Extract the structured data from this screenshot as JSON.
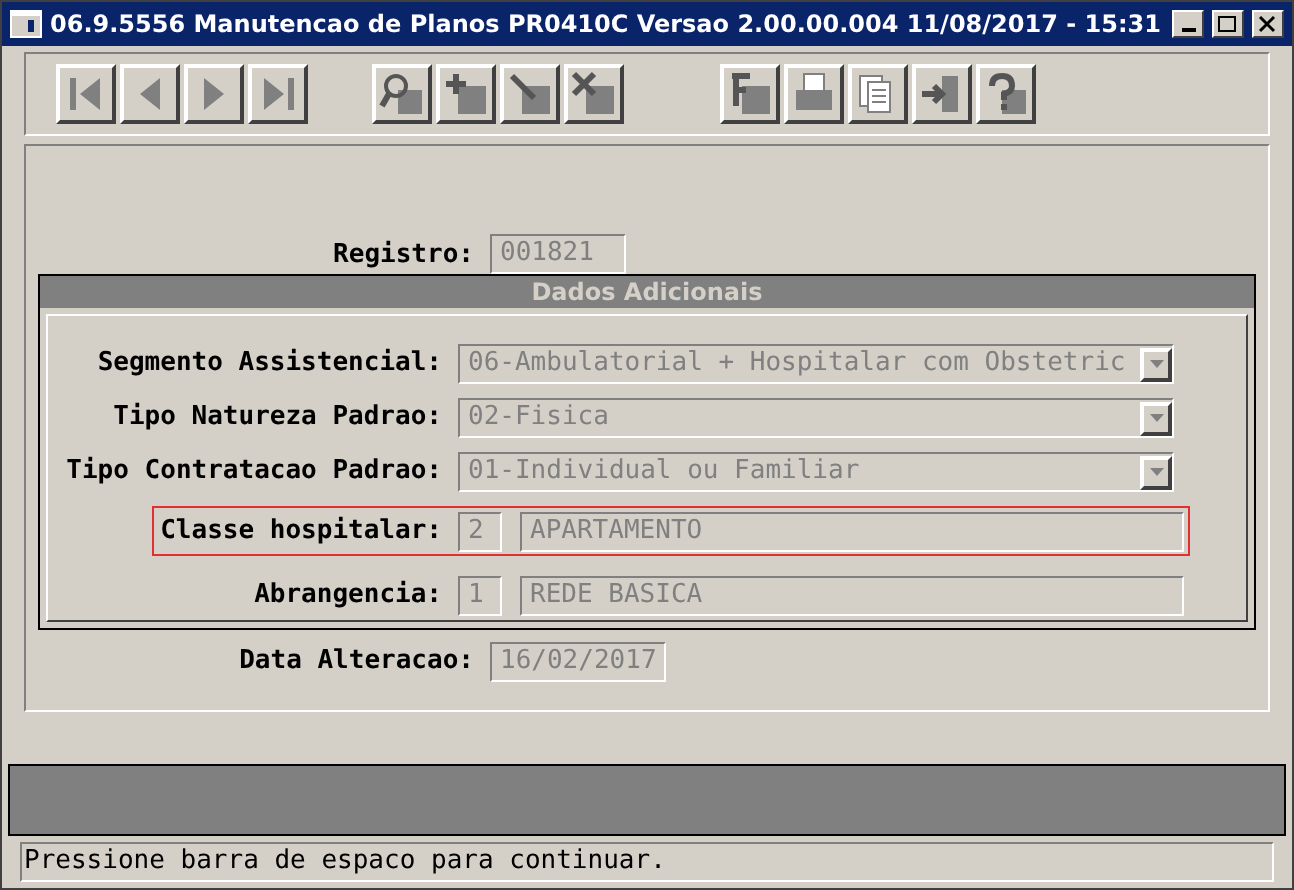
{
  "window": {
    "title": "06.9.5556  Manutencao de Planos PR0410C Versao 2.00.00.004 11/08/2017 - 15:31"
  },
  "toolbar": [
    [
      {
        "kind": "first"
      },
      {
        "kind": "prev"
      },
      {
        "kind": "next"
      },
      {
        "kind": "last"
      }
    ],
    [
      {
        "kind": "search"
      },
      {
        "kind": "add"
      },
      {
        "kind": "edit"
      },
      {
        "kind": "delete"
      }
    ],
    [
      {
        "kind": "filter"
      },
      {
        "kind": "print"
      },
      {
        "kind": "copy"
      },
      {
        "kind": "exit"
      },
      {
        "kind": "help"
      }
    ]
  ],
  "registro": {
    "label": "Registro:",
    "value": "001821"
  },
  "section": {
    "title": "Dados Adicionais",
    "selects": [
      {
        "label": "Segmento Assistencial:",
        "value": "06-Ambulatorial + Hospitalar com Obstetric"
      },
      {
        "label": "Tipo Natureza Padrao:",
        "value": "02-Fisica"
      },
      {
        "label": "Tipo Contratacao Padrao:",
        "value": "01-Individual ou Familiar"
      }
    ],
    "lookups": [
      {
        "label": "Classe hospitalar:",
        "code": "2",
        "description": "APARTAMENTO",
        "highlighted": true
      },
      {
        "label": "Abrangencia:",
        "code": "1",
        "description": "REDE BASICA",
        "highlighted": false
      }
    ]
  },
  "data_alteracao": {
    "label": "Data Alteracao:",
    "value": "16/02/2017"
  },
  "status_bar": {
    "message": "Pressione barra de espaco para continuar."
  }
}
